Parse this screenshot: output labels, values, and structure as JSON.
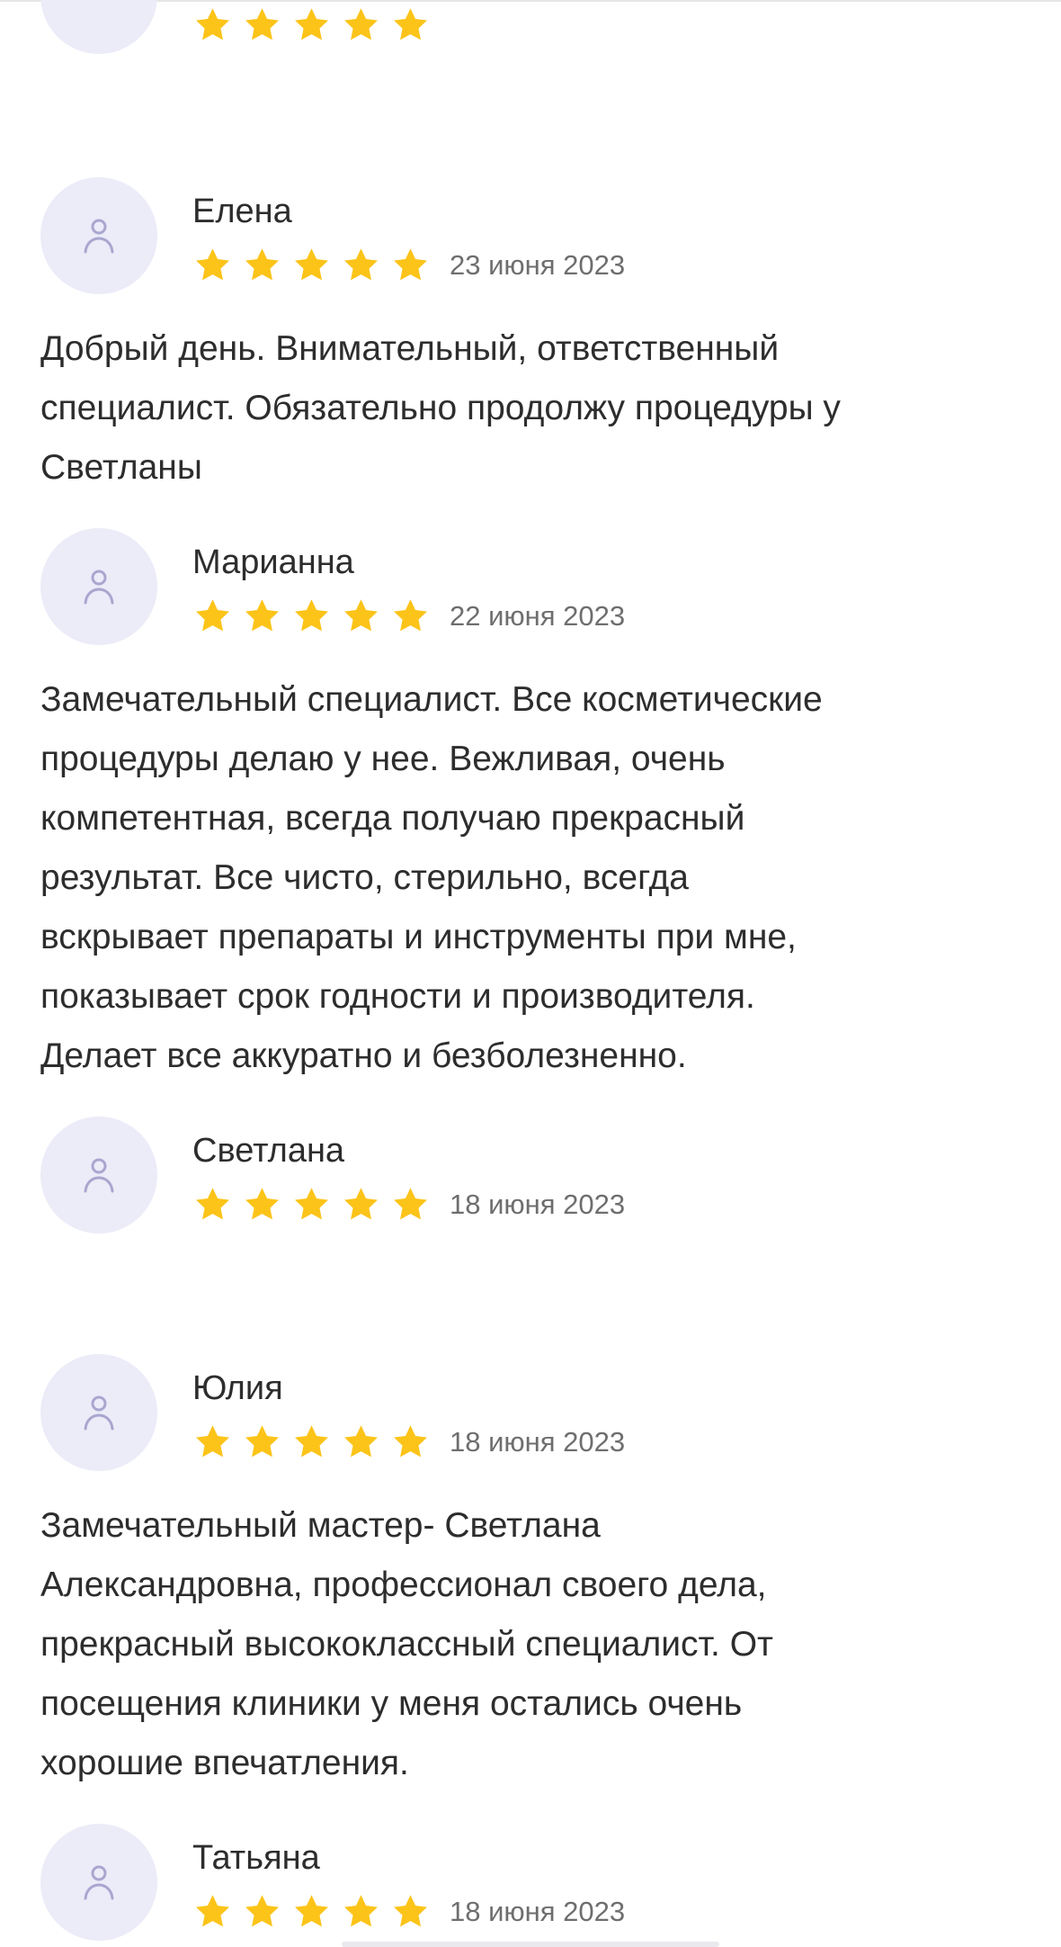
{
  "colors": {
    "star": "#fcc419",
    "avatar_bg": "#ecebf8",
    "avatar_icon": "#a9a6cf",
    "date": "#6e6e6e",
    "text": "#2d2d2d"
  },
  "icons": {
    "avatar": "user-icon",
    "rating": "star-icon"
  },
  "reviews": [
    {
      "name": "Елена",
      "rating": 5,
      "date": "23 июня 2023",
      "text": "Добрый день. Внимательный, ответственный\nспециалист. Обязательно продолжу процедуры у\nСветланы"
    },
    {
      "name": "Марианна",
      "rating": 5,
      "date": "22 июня 2023",
      "text": "Замечательный специалист. Все косметические\nпроцедуры делаю у нее. Вежливая, очень\nкомпетентная, всегда получаю прекрасный\nрезультат. Все чисто, стерильно, всегда\nвскрывает препараты и инструменты при мне,\nпоказывает срок годности и производителя.\nДелает все аккуратно и безболезненно."
    },
    {
      "name": "Светлана",
      "rating": 5,
      "date": "18 июня 2023",
      "text": ""
    },
    {
      "name": "Юлия",
      "rating": 5,
      "date": "18 июня 2023",
      "text": "Замечательный мастер- Светлана\nАлександровна, профессионал своего дела,\nпрекрасный высококлассный специалист. От\nпосещения клиники у меня остались очень\nхорошие впечатления."
    },
    {
      "name": "Татьяна",
      "rating": 5,
      "date": "18 июня 2023",
      "text": ""
    }
  ]
}
